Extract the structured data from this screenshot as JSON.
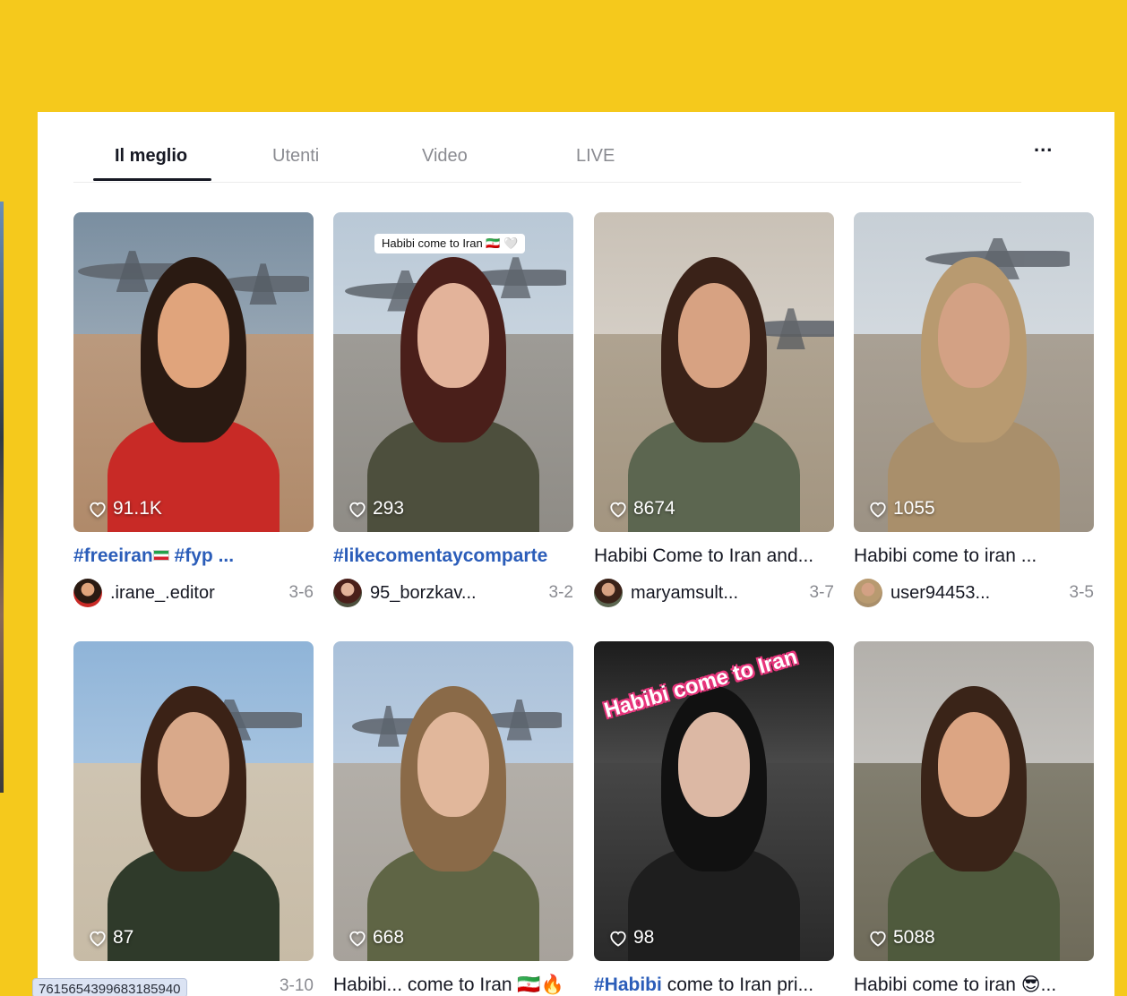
{
  "tabs": [
    {
      "label": "Il meglio",
      "active": true
    },
    {
      "label": "Utenti",
      "active": false
    },
    {
      "label": "Video",
      "active": false
    },
    {
      "label": "LIVE",
      "active": false
    }
  ],
  "more_label": "...",
  "videos": [
    {
      "likes": "91.1K",
      "desc_tag": "#freeiran",
      "desc_text": " #fyp ...",
      "flag": true,
      "flag_after_tag": true,
      "user": ".irane_.editor",
      "date": "3-6",
      "overlay": "",
      "palette": {
        "sky": "#7a8ea0",
        "ground": "#b08a6a",
        "hair": "#2a1a12",
        "face": "#e0a47c",
        "body": "#c82a26"
      }
    },
    {
      "likes": "293",
      "desc_tag": "#likecomentaycomparte",
      "desc_text": "",
      "flag": false,
      "user": "95_borzkav...",
      "date": "3-2",
      "overlay": "Habibi come to Iran 🇮🇷 🤍",
      "palette": {
        "sky": "#b9c8d6",
        "ground": "#8f8c86",
        "hair": "#4a1f1a",
        "face": "#e3b39a",
        "body": "#4d4f3d"
      }
    },
    {
      "likes": "8674",
      "desc_tag": "",
      "desc_text": "Habibi Come to Iran and...",
      "flag": false,
      "user": "maryamsult...",
      "date": "3-7",
      "overlay": "",
      "palette": {
        "sky": "#c9c1b6",
        "ground": "#a39580",
        "hair": "#3a2218",
        "face": "#d7a282",
        "body": "#5c6650"
      }
    },
    {
      "likes": "1055",
      "desc_tag": "",
      "desc_text": "Habibi come to iran ...",
      "flag": false,
      "user": "user94453...",
      "date": "3-5",
      "overlay": "",
      "palette": {
        "sky": "#c7cfd6",
        "ground": "#9c9284",
        "hair": "#b89a70",
        "face": "#d3a184",
        "body": "#a98f6b"
      }
    },
    {
      "likes": "87",
      "desc_tag": "",
      "desc_text": "",
      "flag": false,
      "user": "",
      "date": "3-10",
      "overlay": "",
      "palette": {
        "sky": "#8fb4d8",
        "ground": "#c7bba6",
        "hair": "#3b2216",
        "face": "#d9a98a",
        "body": "#2f3a2a"
      }
    },
    {
      "likes": "668",
      "desc_tag": "",
      "desc_text": "Habibi... come to Iran 🇮🇷🔥",
      "flag": false,
      "user": "",
      "date": "",
      "overlay": "",
      "palette": {
        "sky": "#a9c0d9",
        "ground": "#a7a29b",
        "hair": "#8a6a48",
        "face": "#e1b79b",
        "body": "#5f6545"
      }
    },
    {
      "likes": "98",
      "desc_tag": "#Habibi",
      "desc_text": " come to Iran pri...",
      "flag": false,
      "user": "",
      "date": "",
      "overlay": "Habibi come to Iran",
      "palette": {
        "sky": "#1c1c1c",
        "ground": "#2a2a2a",
        "hair": "#111111",
        "face": "#dcb8a4",
        "body": "#1e1e1e"
      }
    },
    {
      "likes": "5088",
      "desc_tag": "",
      "desc_text": "Habibi come to iran 😎...",
      "flag": false,
      "user": "",
      "date": "",
      "overlay": "",
      "palette": {
        "sky": "#b3b0ab",
        "ground": "#6f6b5a",
        "hair": "#3a2418",
        "face": "#dca583",
        "body": "#4f5a3d"
      }
    }
  ],
  "url_tooltip": "7615654399683185940",
  "colors": {
    "page_bg": "#f5c91c",
    "panel_bg": "#ffffff",
    "hashtag": "#2b5db9",
    "muted": "#8a8b91",
    "text": "#161823"
  }
}
